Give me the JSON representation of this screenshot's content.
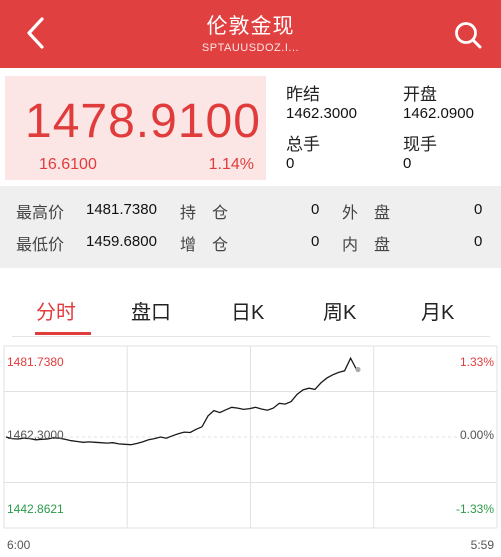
{
  "header": {
    "title": "伦敦金现",
    "subtitle": "SPTAUUSDOZ.I..."
  },
  "quote": {
    "price": "1478.9100",
    "change": "16.6100",
    "change_pct": "1.14%",
    "prev_close_label": "昨结",
    "prev_close": "1462.3000",
    "open_label": "开盘",
    "open": "1462.0900",
    "total_vol_label": "总手",
    "total_vol": "0",
    "cur_vol_label": "现手",
    "cur_vol": "0"
  },
  "stats": {
    "high_label": "最高价",
    "high": "1481.7380",
    "low_label": "最低价",
    "low": "1459.6800",
    "hold_label": "持　仓",
    "hold": "0",
    "add_label": "增　仓",
    "add": "0",
    "outer_label": "外　盘",
    "outer": "0",
    "inner_label": "内　盘",
    "inner": "0"
  },
  "tabs": [
    "分时",
    "盘口",
    "日K",
    "周K",
    "月K"
  ],
  "chart_data": {
    "type": "line",
    "y_top": "1481.7380",
    "y_mid": "1462.3000",
    "y_bot": "1442.8621",
    "pct_top": "1.33%",
    "pct_mid": "0.00%",
    "pct_bot": "-1.33%",
    "x_start": "6:00",
    "x_end": "5:59",
    "ylim": [
      1442.8621,
      1481.738
    ],
    "series": [
      {
        "values": [
          1462.3,
          1461.9,
          1461.8,
          1462.0,
          1461.9,
          1461.6,
          1461.7,
          1461.8,
          1462.1,
          1462.0,
          1461.7,
          1461.4,
          1461.2,
          1461.0,
          1461.1,
          1461.0,
          1460.9,
          1460.8,
          1460.9,
          1460.6,
          1460.5,
          1460.4,
          1460.7,
          1461.1,
          1461.6,
          1461.9,
          1462.3,
          1462.0,
          1462.6,
          1463.1,
          1463.5,
          1463.4,
          1464.2,
          1464.8,
          1467.5,
          1468.8,
          1468.3,
          1469.0,
          1469.6,
          1469.4,
          1469.1,
          1469.3,
          1469.6,
          1469.2,
          1468.9,
          1469.4,
          1470.6,
          1470.4,
          1471.0,
          1472.8,
          1473.9,
          1474.3,
          1474.0,
          1475.6,
          1476.8,
          1477.6,
          1478.2,
          1478.6,
          1481.7,
          1478.9
        ]
      }
    ],
    "line_color": "#1a1a1a",
    "up_color": "#e03c3c",
    "down_color": "#2a9a4a"
  }
}
